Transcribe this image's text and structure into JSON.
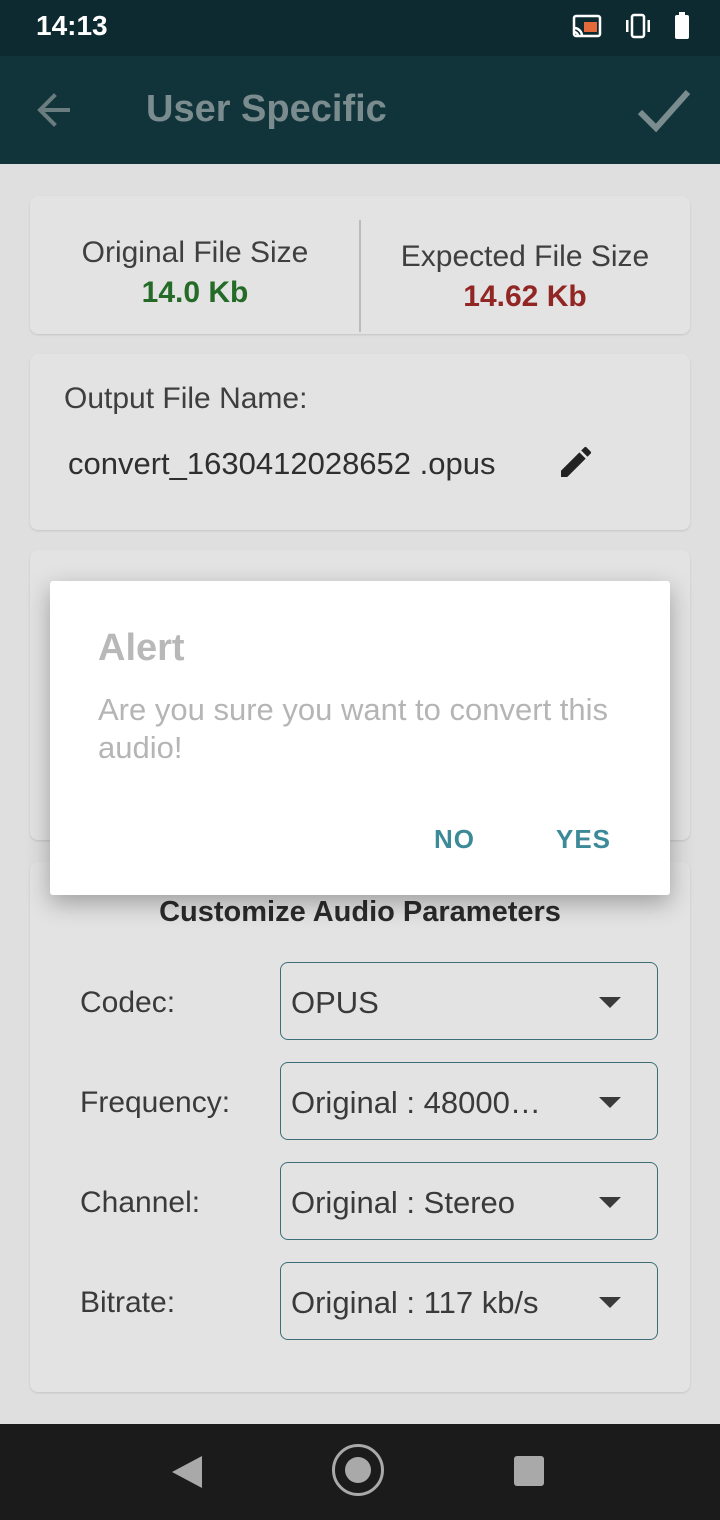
{
  "status_bar": {
    "time": "14:13"
  },
  "app_bar": {
    "title": "User Specific"
  },
  "file_sizes": {
    "original_label": "Original File Size",
    "original_value": "14.0 Kb",
    "expected_label": "Expected File Size",
    "expected_value": "14.62 Kb"
  },
  "output": {
    "label": "Output File Name:",
    "file_name": "convert_1630412028652 .opus"
  },
  "params": {
    "title": "Customize Audio Parameters",
    "rows": [
      {
        "label": "Codec:",
        "value": "OPUS"
      },
      {
        "label": "Frequency:",
        "value": "Original : 48000…"
      },
      {
        "label": "Channel:",
        "value": "Original : Stereo"
      },
      {
        "label": "Bitrate:",
        "value": "Original : 117 kb/s"
      }
    ]
  },
  "dialog": {
    "title": "Alert",
    "message": "Are you sure you want to convert this audio!",
    "no_label": "NO",
    "yes_label": "YES"
  },
  "colors": {
    "original_size": "#246b27",
    "expected_size": "#912624",
    "accent": "#3c8a98"
  },
  "icons": [
    "cast-icon",
    "vibrate-icon",
    "battery-icon",
    "back-arrow-icon",
    "check-icon",
    "edit-pencil-icon",
    "dropdown-arrow-icon",
    "nav-back-icon",
    "nav-home-icon",
    "nav-recents-icon"
  ]
}
